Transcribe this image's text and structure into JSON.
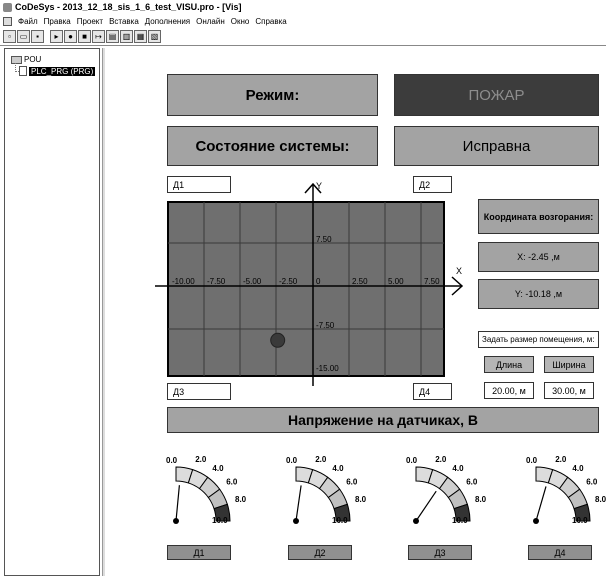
{
  "window": {
    "title": "CoDeSys - 2013_12_18_sis_1_6_test_VISU.pro - [Vis]",
    "menu": [
      "Файл",
      "Правка",
      "Проект",
      "Вставка",
      "Дополнения",
      "Онлайн",
      "Окно",
      "Справка"
    ],
    "toolbar_icons": [
      "new-icon",
      "open-icon",
      "save-icon",
      "login-icon",
      "run-icon",
      "stop-icon",
      "step-icon",
      "print-icon",
      "build-icon",
      "monitor-icon",
      "debug-icon"
    ]
  },
  "tree": {
    "root": "POU",
    "selected_item": "PLC_PRG (PRG)"
  },
  "visu": {
    "mode_label": "Режим:",
    "mode_value": "ПОЖАР",
    "state_label": "Состояние системы:",
    "state_value": "Исправна",
    "sensor_corner_labels": [
      "Д1",
      "Д2",
      "Д3",
      "Д4"
    ],
    "coord_title": "Координата возгорания:",
    "coord_x": "X:   -2.45 ,м",
    "coord_y": "Y:   -10.18 ,м",
    "room_size_label": "Задать размер помещения, м:",
    "length_button": "Длина",
    "width_button": "Ширина",
    "length_value": "20.00, м",
    "width_value": "30.00, м",
    "voltage_title": "Напряжение на датчиках, В",
    "colors": {
      "panel": "#a3a3a3",
      "dark_panel": "#3c3c3c",
      "grid_bg": "#6f6f6f"
    }
  },
  "plot": {
    "x_axis_label": "X",
    "y_axis_label": "Y",
    "x_ticks": [
      "-10.00",
      "-7.50",
      "-5.00",
      "-2.50",
      "0",
      "2.50",
      "5.00",
      "7.50"
    ],
    "y_ticks": [
      "7.50",
      "-7.50",
      "-15.00"
    ],
    "fire_point": {
      "x": -2.45,
      "y": -10.18
    }
  },
  "gauges": [
    {
      "sensor": "Д1",
      "value": 0.6
    },
    {
      "sensor": "Д2",
      "value": 0.9
    },
    {
      "sensor": "Д3",
      "value": 3.8
    },
    {
      "sensor": "Д4",
      "value": 1.8
    }
  ],
  "gauge_scale": [
    "0.0",
    "2.0",
    "4.0",
    "6.0",
    "8.0",
    "10.0"
  ]
}
